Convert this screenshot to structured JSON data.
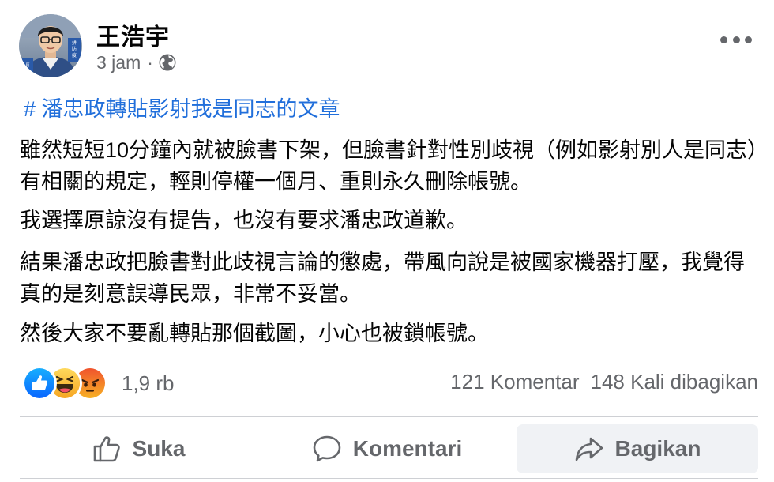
{
  "author": {
    "name": "王浩宇",
    "avatar_sign_left": "厠鑼",
    "avatar_sign_right": "拼防疫"
  },
  "meta": {
    "time": "3 jam",
    "separator": "·",
    "privacy_icon": "globe-icon"
  },
  "more_icon": "more-horizontal-icon",
  "post": {
    "hashtag": "# 潘忠政轉貼影射我是同志的文章",
    "paragraphs": [
      "雖然短短10分鐘內就被臉書下架，但臉書針對性別歧視（例如影射別人是同志）有相關的規定，輕則停權一個月、重則永久刪除帳號。",
      "我選擇原諒沒有提告，也沒有要求潘忠政道歉。",
      "結果潘忠政把臉書對此歧視言論的懲處，帶風向說是被國家機器打壓，我覺得真的是刻意誤導民眾，非常不妥當。",
      "然後大家不要亂轉貼那個截圖，小心也被鎖帳號。"
    ]
  },
  "reactions": {
    "icons": [
      "like-reaction-icon",
      "haha-reaction-icon",
      "angry-reaction-icon"
    ],
    "count": "1,9 rb"
  },
  "stats": {
    "comments": "121 Komentar",
    "shares": "148 Kali dibagikan"
  },
  "actions": {
    "like_label": "Suka",
    "comment_label": "Komentari",
    "share_label": "Bagikan"
  },
  "colors": {
    "link": "#216fdb",
    "secondary_text": "#65676b",
    "like_blue": "#1877f2",
    "haha_yellow": "#f7b125",
    "angry_orange": "#e9710f"
  }
}
